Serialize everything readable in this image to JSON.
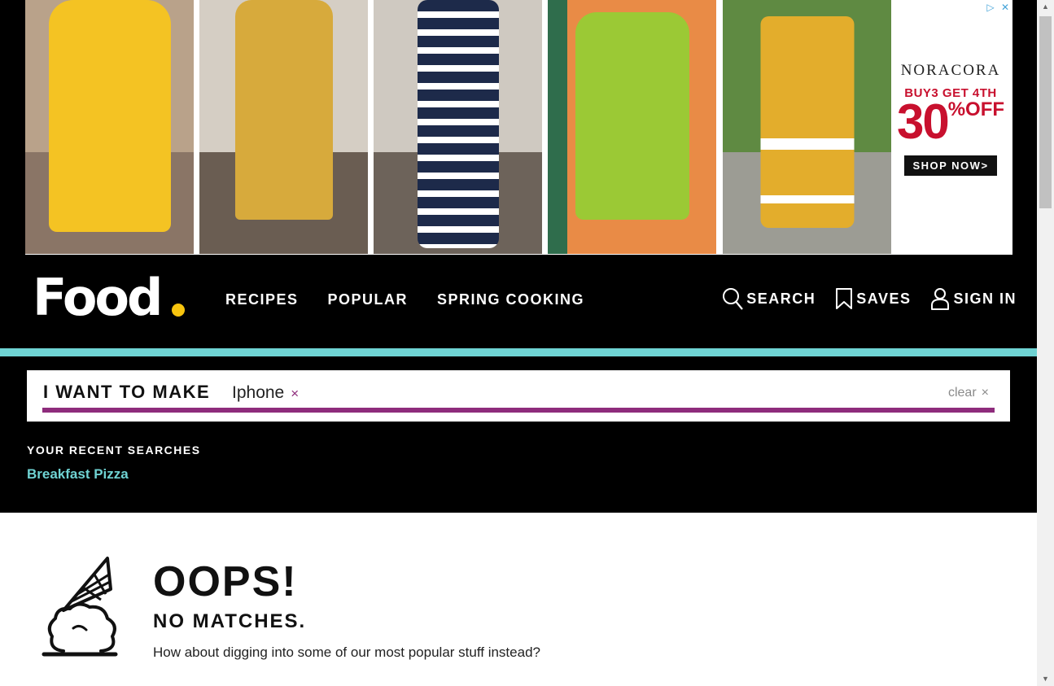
{
  "ad": {
    "brand": "NORACORA",
    "offer_line": "BUY3 GET 4TH",
    "discount_number": "30",
    "discount_pct": "%",
    "discount_off": "OFF",
    "cta": "SHOP NOW>",
    "adchoices_icon": "play-triangle-icon",
    "close_icon": "close-icon"
  },
  "header": {
    "logo": "Food",
    "nav": [
      {
        "label": "RECIPES"
      },
      {
        "label": "POPULAR"
      },
      {
        "label": "SPRING COOKING"
      }
    ],
    "search_label": "SEARCH",
    "saves_label": "SAVES",
    "signin_label": "SIGN IN",
    "accent_teal": "#6fd3d3",
    "logo_dot_color": "#f7c40e"
  },
  "search": {
    "label": "I WANT TO MAKE",
    "chip": "Iphone",
    "chip_remove": "×",
    "clear": "clear",
    "clear_x": "×",
    "underline_color": "#8e2c7c",
    "recent_title": "YOUR RECENT SEARCHES",
    "recent": [
      "Breakfast Pizza"
    ]
  },
  "results": {
    "title": "OOPS!",
    "subtitle": "NO MATCHES.",
    "message": "How about digging into some of our most popular stuff instead?",
    "icon": "dropped-ice-cream-cone-icon"
  }
}
